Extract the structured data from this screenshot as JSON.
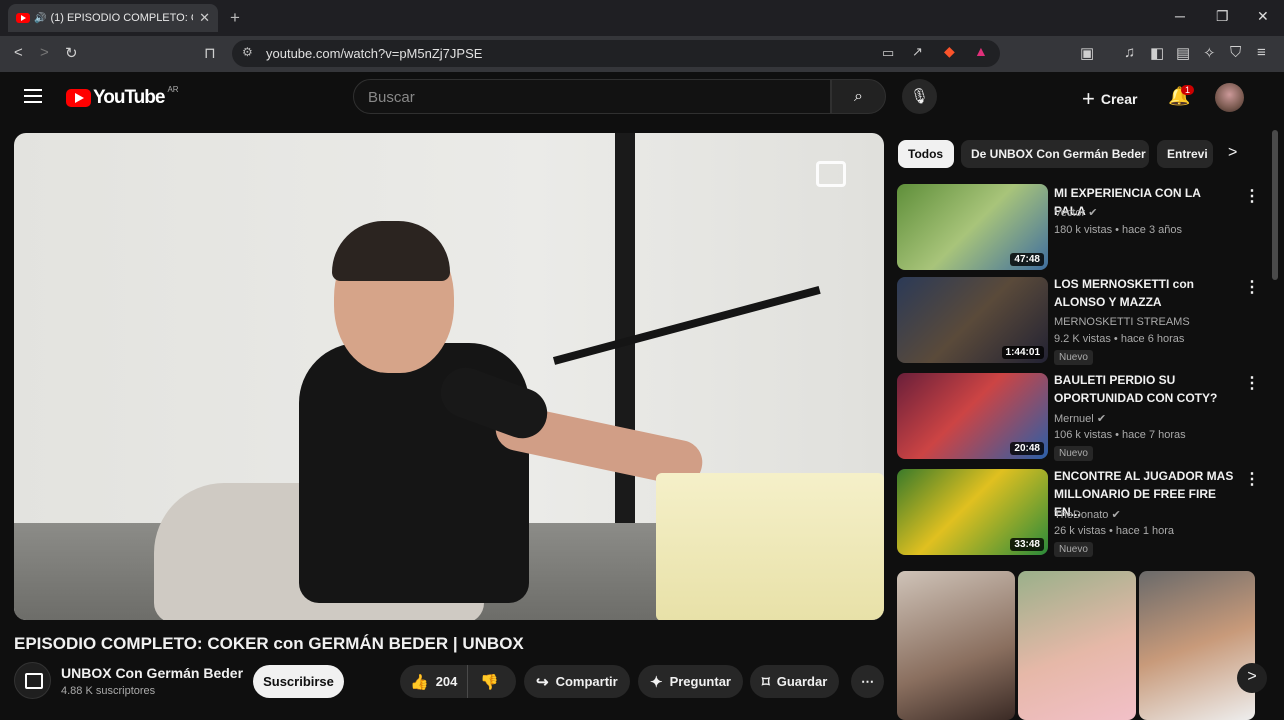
{
  "browser": {
    "tab_title": "(1) EPISODIO COMPLETO: CO",
    "url": "youtube.com/watch?v=pM5nZj7JPSE"
  },
  "header": {
    "logo_text": "YouTube",
    "logo_country": "AR",
    "search_placeholder": "Buscar",
    "create_label": "Crear",
    "notifications_count": "1"
  },
  "video": {
    "title": "EPISODIO COMPLETO: COKER con GERMÁN BEDER | UNBOX",
    "channel_name": "UNBOX Con Germán Beder",
    "subscribers": "4.88 K suscriptores",
    "subscribe_label": "Suscribirse",
    "likes": "204",
    "share_label": "Compartir",
    "ask_label": "Preguntar",
    "save_label": "Guardar"
  },
  "sidebar": {
    "chips": [
      "Todos",
      "De UNBOX Con Germán Beder",
      "Entrevi"
    ],
    "recommendations": [
      {
        "title_line1": "MI EXPERIENCIA CON LA PALA",
        "title_line2": "",
        "channel": "Vector",
        "meta": "180 k vistas • hace 3 años",
        "duration": "47:48",
        "nuevo": ""
      },
      {
        "title_line1": "LOS MERNOSKETTI con",
        "title_line2": "ALONSO Y MAZZA",
        "channel": "MERNOSKETTI STREAMS",
        "meta": "9.2 K vistas • hace 6 horas",
        "duration": "1:44:01",
        "nuevo": "Nuevo"
      },
      {
        "title_line1": "BAULETI PERDIO SU",
        "title_line2": "OPORTUNIDAD CON COTY?",
        "channel": "Mernuel",
        "meta": "106 k vistas • hace 7 horas",
        "duration": "20:48",
        "nuevo": "Nuevo"
      },
      {
        "title_line1": "ENCONTRE AL JUGADOR MAS",
        "title_line2": "MILLONARIO DE FREE FIRE EN...",
        "channel": "TheDonato",
        "meta": "26 k vistas • hace 1 hora",
        "duration": "33:48",
        "nuevo": "Nuevo"
      }
    ]
  },
  "colors": {
    "brand": "#ff0000",
    "background": "#0f0f0f",
    "chip": "#272727"
  }
}
